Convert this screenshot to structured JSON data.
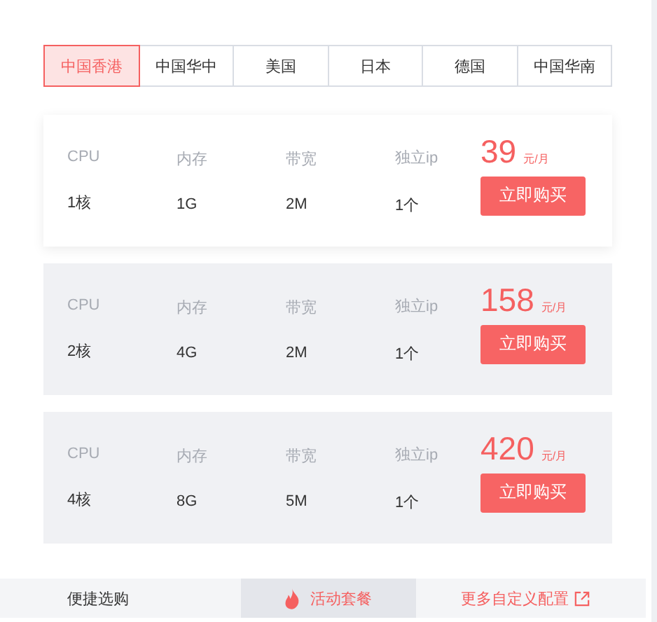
{
  "regions": [
    {
      "label": "中国香港",
      "selected": true
    },
    {
      "label": "中国华中",
      "selected": false
    },
    {
      "label": "美国",
      "selected": false
    },
    {
      "label": "日本",
      "selected": false
    },
    {
      "label": "德国",
      "selected": false
    },
    {
      "label": "中国华南",
      "selected": false
    }
  ],
  "plans": [
    {
      "highlighted": true,
      "specs": [
        {
          "label": "CPU",
          "value": "1核"
        },
        {
          "label": "内存",
          "value": "1G"
        },
        {
          "label": "带宽",
          "value": "2M"
        },
        {
          "label": "独立ip",
          "value": "1个"
        }
      ],
      "price": "39",
      "unit": "元/月",
      "button": "立即购买"
    },
    {
      "highlighted": false,
      "specs": [
        {
          "label": "CPU",
          "value": "2核"
        },
        {
          "label": "内存",
          "value": "4G"
        },
        {
          "label": "带宽",
          "value": "2M"
        },
        {
          "label": "独立ip",
          "value": "1个"
        }
      ],
      "price": "158",
      "unit": "元/月",
      "button": "立即购买"
    },
    {
      "highlighted": false,
      "specs": [
        {
          "label": "CPU",
          "value": "4核"
        },
        {
          "label": "内存",
          "value": "8G"
        },
        {
          "label": "带宽",
          "value": "5M"
        },
        {
          "label": "独立ip",
          "value": "1个"
        }
      ],
      "price": "420",
      "unit": "元/月",
      "button": "立即购买"
    }
  ],
  "bottom_tabs": [
    {
      "kind": "plain",
      "label": "便捷选购",
      "selected": false
    },
    {
      "kind": "hot",
      "label": "活动套餐",
      "selected": true
    },
    {
      "kind": "external",
      "label": "更多自定义配置",
      "selected": false
    }
  ]
}
